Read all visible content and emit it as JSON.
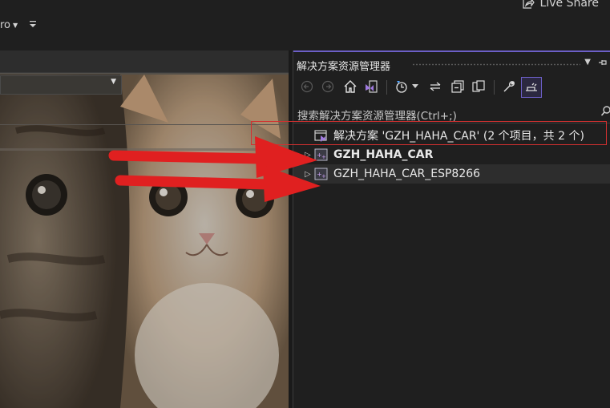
{
  "topbar": {
    "live_share_label": "Live Share",
    "left_fragment": "ro",
    "live_share_icon": "live-share-icon"
  },
  "editor": {
    "background_image": "two-kittens-photo",
    "dropdown_value": ""
  },
  "solution_explorer": {
    "title": "解决方案资源管理器",
    "search_placeholder": "搜索解决方案资源管理器(Ctrl+;)",
    "toolbar_icons": [
      "back-icon",
      "forward-icon",
      "home-icon",
      "vs-switch-views-icon",
      "pending-changes-icon",
      "dropdown-arrow-icon",
      "sync-icon",
      "collapse-all-icon",
      "show-all-files-icon",
      "properties-wrench-icon",
      "preview-selected-icon"
    ],
    "solution": {
      "label": "解决方案 'GZH_HAHA_CAR' (2 个项目，共 2 个)"
    },
    "projects": [
      {
        "label": "GZH_HAHA_CAR",
        "bold": true
      },
      {
        "label": "GZH_HAHA_CAR_ESP8266",
        "bold": false
      }
    ]
  },
  "colors": {
    "accent": "#6c5fc7",
    "annotation_red": "#e02020",
    "panel_bg": "#1f1f1f"
  }
}
